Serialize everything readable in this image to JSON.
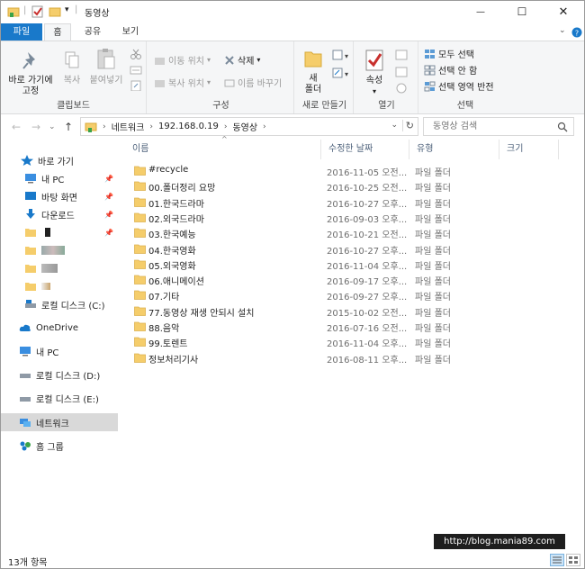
{
  "window": {
    "title": "동영상",
    "minimize": "—",
    "maximize": "☐",
    "close": "✕"
  },
  "ribbon_tabs": [
    {
      "label": "파일"
    },
    {
      "label": "홈"
    },
    {
      "label": "공유"
    },
    {
      "label": "보기"
    }
  ],
  "ribbon": {
    "clipboard": {
      "pin_label_1": "바로 가기에",
      "pin_label_2": "고정",
      "copy": "복사",
      "paste": "붙여넣기",
      "group": "클립보드"
    },
    "organize": {
      "move_to": "이동 위치",
      "copy_to": "복사 위치",
      "delete": "삭제",
      "rename": "이름 바꾸기",
      "group": "구성"
    },
    "new": {
      "new_folder_1": "새",
      "new_folder_2": "폴더",
      "group": "새로 만들기"
    },
    "open": {
      "properties": "속성",
      "group": "열기"
    },
    "select": {
      "select_all": "모두 선택",
      "select_none": "선택 안 함",
      "invert": "선택 영역 반전",
      "group": "선택"
    }
  },
  "address": {
    "crumbs": [
      "네트워크",
      "192.168.0.19",
      "동영상"
    ],
    "search_placeholder": "동영상 검색"
  },
  "nav_pane": {
    "quick_access": "바로 가기",
    "pinned": [
      {
        "label": "내 PC"
      },
      {
        "label": "바탕 화면"
      },
      {
        "label": "다운로드"
      }
    ],
    "local_disk_c": "로컬 디스크 (C:)",
    "onedrive": "OneDrive",
    "this_pc": "내 PC",
    "local_disk_d": "로컬 디스크 (D:)",
    "local_disk_e": "로컬 디스크 (E:)",
    "network": "네트워크",
    "homegroup": "홈 그룹"
  },
  "columns": {
    "name": "이름",
    "modified": "수정한 날짜",
    "type": "유형",
    "size": "크기"
  },
  "files": [
    {
      "name": "#recycle",
      "date": "2016-11-05 오전...",
      "type": "파일 폴더"
    },
    {
      "name": "00.폴더정리 요망",
      "date": "2016-10-25 오전...",
      "type": "파일 폴더"
    },
    {
      "name": "01.한국드라마",
      "date": "2016-10-27 오후...",
      "type": "파일 폴더"
    },
    {
      "name": "02.외국드라마",
      "date": "2016-09-03 오후...",
      "type": "파일 폴더"
    },
    {
      "name": "03.한국예능",
      "date": "2016-10-21 오전...",
      "type": "파일 폴더"
    },
    {
      "name": "04.한국영화",
      "date": "2016-10-27 오후...",
      "type": "파일 폴더"
    },
    {
      "name": "05.외국영화",
      "date": "2016-11-04 오후...",
      "type": "파일 폴더"
    },
    {
      "name": "06.애니메이션",
      "date": "2016-09-17 오후...",
      "type": "파일 폴더"
    },
    {
      "name": "07.기타",
      "date": "2016-09-27 오후...",
      "type": "파일 폴더"
    },
    {
      "name": "77.동영상 재생 안되시 설치",
      "date": "2015-10-02 오전...",
      "type": "파일 폴더"
    },
    {
      "name": "88.음악",
      "date": "2016-07-16 오전...",
      "type": "파일 폴더"
    },
    {
      "name": "99.토렌트",
      "date": "2016-11-04 오후...",
      "type": "파일 폴더"
    },
    {
      "name": "정보처리기사",
      "date": "2016-08-11 오후...",
      "type": "파일 폴더"
    }
  ],
  "status": {
    "item_count": "13개 항목",
    "watermark": "http://blog.mania89.com"
  },
  "colors": {
    "accent": "#1979ca",
    "folder": "#f5cd6b",
    "selected_nav": "#d9d9d9"
  }
}
